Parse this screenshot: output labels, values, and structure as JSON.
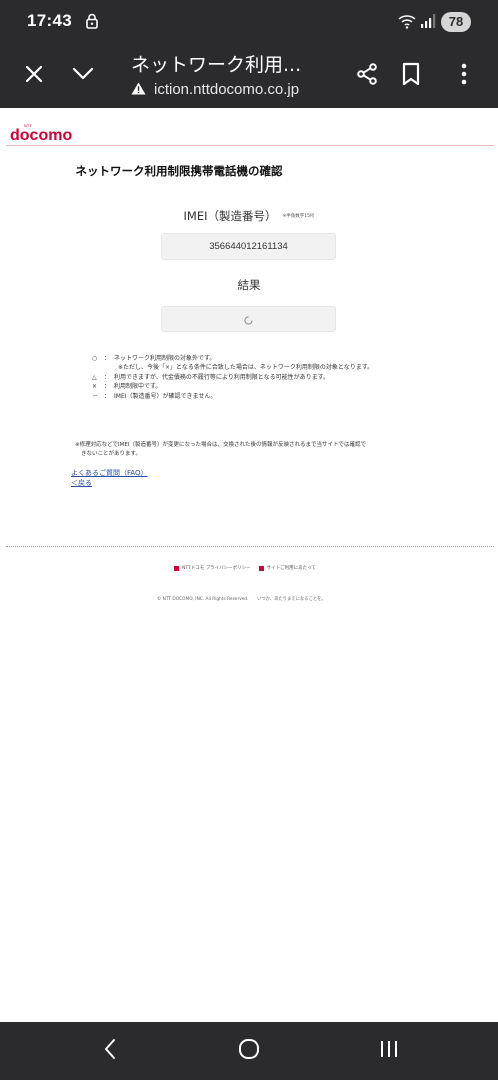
{
  "status_bar": {
    "time": "17:43",
    "battery": "78",
    "icons": [
      "lock-icon",
      "wifi-icon",
      "signal-icon"
    ]
  },
  "browser": {
    "page_title": "ネットワーク利用...",
    "url": "iction.nttdocomo.co.jp",
    "icons": [
      "close-icon",
      "chevron-down-icon",
      "warning-icon",
      "share-icon",
      "bookmark-icon",
      "more-vertical-icon"
    ]
  },
  "site": {
    "logo_small": "NTT",
    "logo_text": "docomo",
    "heading": "ネットワーク利用制限携帯電話機の確認",
    "imei_label": "IMEI（製造番号）",
    "imei_note": "※半角数字15桁",
    "imei_value": "356644012161134",
    "result_label": "結果",
    "legend": [
      {
        "symbol": "○",
        "text": "ネットワーク利用制限の対象外です。"
      },
      {
        "symbol": "",
        "text": "※ただし、今後「×」となる条件に合致した場合は、ネットワーク利用制限の対象となります。"
      },
      {
        "symbol": "△",
        "text": "利用できますが、代金債務の不履行等により利用制限となる可能性があります。"
      },
      {
        "symbol": "×",
        "text": "利用制限中です。"
      },
      {
        "symbol": "－",
        "text": "IMEI（製造番号）が確認できません。"
      }
    ],
    "note_line1": "※修理対応などでIMEI（製造番号）が変更になった場合は、交換された後の情報が反映されるまで当サイトでは確認で",
    "note_line2": "きないことがあります。",
    "faq_link": "よくあるご質問（FAQ）",
    "back_link": "＜戻る",
    "footer_links": [
      "NTTドコモ プライバシーポリシー",
      "サイトご利用にあたって"
    ],
    "copyright": "© NTT DOCOMO, INC. All Rights Reserved.　　いつか、あたりまえになることを。"
  },
  "colors": {
    "chrome": "#2b2b2e",
    "brand_red": "#cc0033",
    "link": "#2a4fa8"
  }
}
